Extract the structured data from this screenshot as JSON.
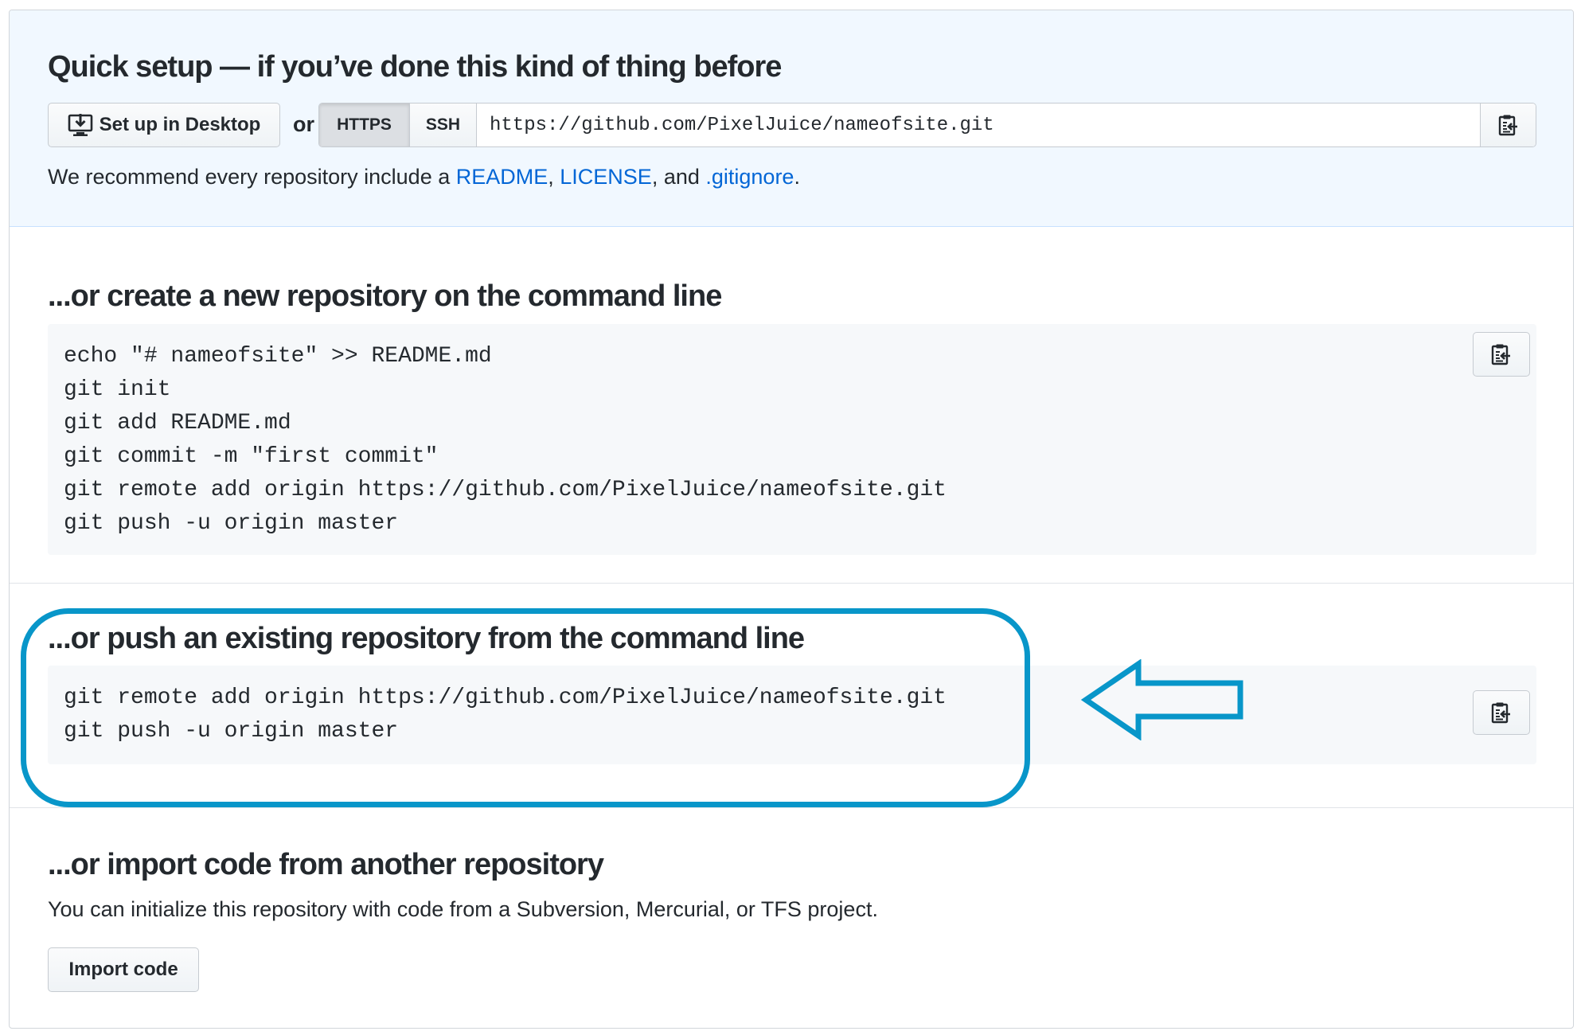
{
  "quick_setup": {
    "title": "Quick setup — if you’ve done this kind of thing before",
    "desktop_button": "Set up in Desktop",
    "or_label": "or",
    "protocols": [
      "HTTPS",
      "SSH"
    ],
    "selected_protocol": "HTTPS",
    "clone_url": "https://github.com/PixelJuice/nameofsite.git",
    "recommend": {
      "prefix": "We recommend every repository include a ",
      "readme": "README",
      "comma": ", ",
      "license": "LICENSE",
      "and": ", and ",
      "gitignore": ".gitignore",
      "suffix": "."
    }
  },
  "create_section": {
    "title": "...or create a new repository on the command line",
    "lines": [
      "echo \"# nameofsite\" >> README.md",
      "git init",
      "git add README.md",
      "git commit -m \"first commit\"",
      "git remote add origin https://github.com/PixelJuice/nameofsite.git",
      "git push -u origin master"
    ]
  },
  "push_section": {
    "title": "...or push an existing repository from the command line",
    "lines": [
      "git remote add origin https://github.com/PixelJuice/nameofsite.git",
      "git push -u origin master"
    ]
  },
  "import_section": {
    "title": "...or import code from another repository",
    "description": "You can initialize this repository with code from a Subversion, Mercurial, or TFS project.",
    "button": "Import code"
  },
  "icons": {
    "desktop": "desktop-download-icon",
    "copy": "clippy-icon"
  },
  "colors": {
    "link": "#0366d6",
    "quick_bg": "#f1f8ff",
    "code_bg": "#f6f8fa",
    "annotation": "#0896c9"
  }
}
